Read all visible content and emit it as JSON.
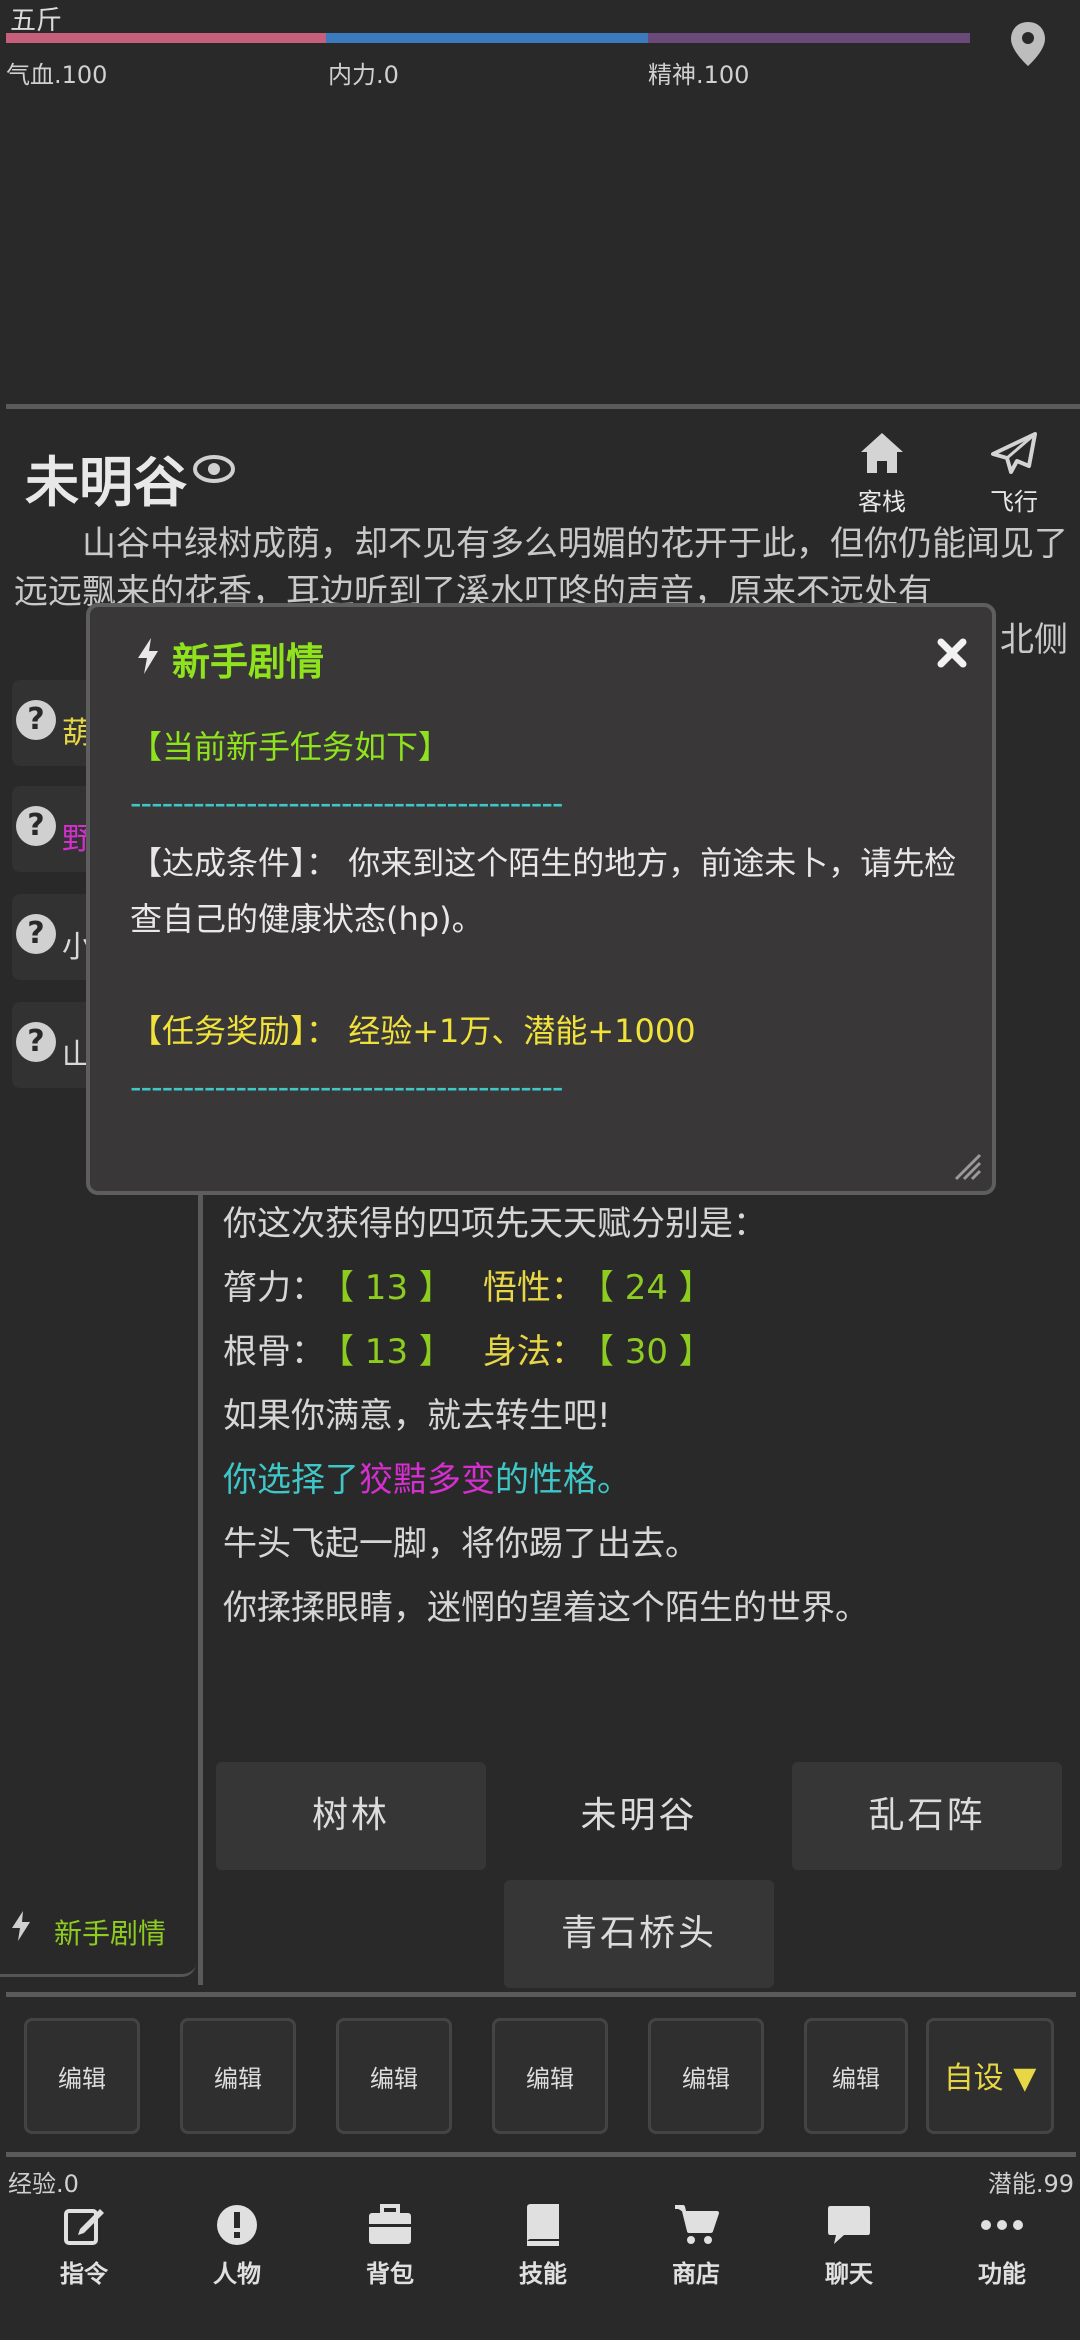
{
  "status": {
    "name": "五斤",
    "hp_label": "气血.100",
    "mp_label": "内力.0",
    "spirit_label": "精神.100",
    "bar_colors": {
      "hp": "#c55f7b",
      "mp": "#3b7bbd",
      "spirit": "#6a4a78"
    }
  },
  "location": {
    "title": "未明谷",
    "description": "山谷中绿树成荫，却不见有多么明媚的花开于此，但你仍能闻见了远远飘来的花香，耳边听到了溪水叮咚的声音，原来不远处有",
    "description_right_fragment": "北侧",
    "actions": [
      {
        "label": "客栈",
        "icon": "home-icon"
      },
      {
        "label": "飞行",
        "icon": "send-icon"
      }
    ]
  },
  "npcs": [
    {
      "name": "葫",
      "color": "#e7d646"
    },
    {
      "name": "野",
      "color": "#d62fcf"
    },
    {
      "name": "小",
      "color": "#d6d6d6"
    },
    {
      "name": "山",
      "color": "#d6d6d6"
    }
  ],
  "log": {
    "line1": "你这次获得的四项先天天赋分别是：",
    "str_label": "膂力：",
    "str_val": "【 13 】",
    "int_label": "悟性：",
    "int_val": "【 24 】",
    "con_label": "根骨：",
    "con_val": "【 13 】",
    "dex_label": "身法：",
    "dex_val": "【 30 】",
    "line4": "如果你满意，就去转生吧!",
    "line5a": "你选择了",
    "line5b": "狡黠多变",
    "line5c": "的性格",
    "line5d": "。",
    "line6": "牛头飞起一脚，将你踢了出去。",
    "line7": "你揉揉眼睛，迷惘的望着这个陌生的世界。"
  },
  "exits": [
    "树林",
    "未明谷",
    "乱石阵",
    "青石桥头"
  ],
  "newbie_tab": {
    "label": "新手剧情"
  },
  "shortcuts": [
    "编辑",
    "编辑",
    "编辑",
    "编辑",
    "编辑",
    "编辑"
  ],
  "custom_label": "自设 ▼",
  "exp": "经验.0",
  "potential": "潜能.99",
  "nav": [
    {
      "label": "指令",
      "icon": "edit-icon"
    },
    {
      "label": "人物",
      "icon": "alert-icon"
    },
    {
      "label": "背包",
      "icon": "briefcase-icon"
    },
    {
      "label": "技能",
      "icon": "book-icon"
    },
    {
      "label": "商店",
      "icon": "cart-icon"
    },
    {
      "label": "聊天",
      "icon": "chat-icon"
    },
    {
      "label": "功能",
      "icon": "more-icon"
    }
  ],
  "modal": {
    "title": "新手剧情",
    "heading": "【当前新手任务如下】",
    "divider": "-----------------------------------------",
    "cond_label": "【达成条件】：",
    "cond_text": "你来到这个陌生的地方，前途未卜，请先检查自己的健康状态(hp)。",
    "reward_label": "【任务奖励】：",
    "reward_text": "经验+1万、潜能+1000"
  }
}
